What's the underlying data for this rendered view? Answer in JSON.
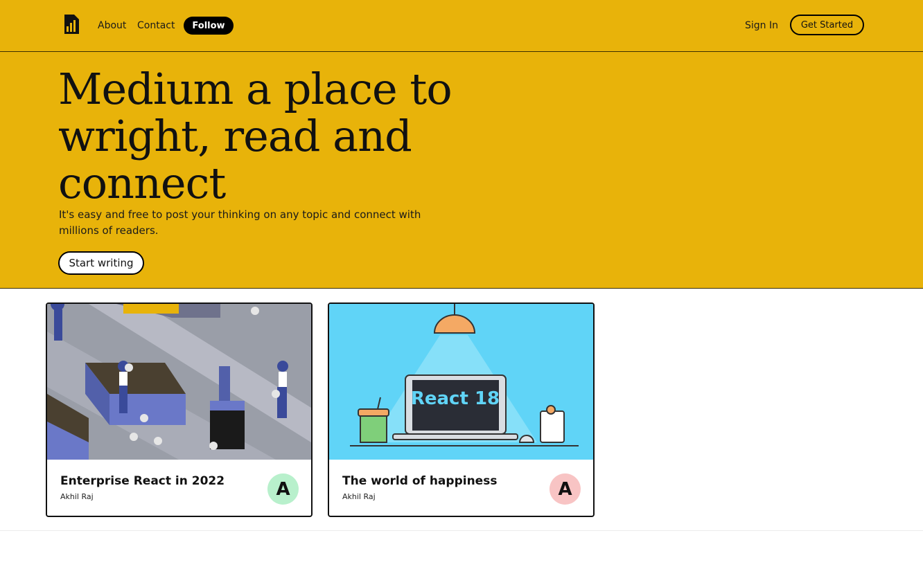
{
  "header": {
    "nav": [
      "About",
      "Contact"
    ],
    "follow_label": "Follow",
    "signin_label": "Sign In",
    "get_started_label": "Get Started"
  },
  "hero": {
    "title": "Medium a place to wright, read and connect",
    "subtitle": "It's easy and free to post your thinking on any topic and connect with millions of readers.",
    "cta_label": "Start writing"
  },
  "cards": [
    {
      "title": "Enterprise React in 2022",
      "author": "Akhil Raj",
      "avatar_letter": "A",
      "avatar_color": "#b8f0cc",
      "image": "isometric-factory-workers-illustration"
    },
    {
      "title": "The world of happiness",
      "author": "Akhil Raj",
      "avatar_letter": "A",
      "avatar_color": "#f8c4c4",
      "image": "react-18-laptop-illustration",
      "image_text": "React 18"
    }
  ],
  "colors": {
    "brand": "#e8b30a",
    "text": "#111111"
  }
}
